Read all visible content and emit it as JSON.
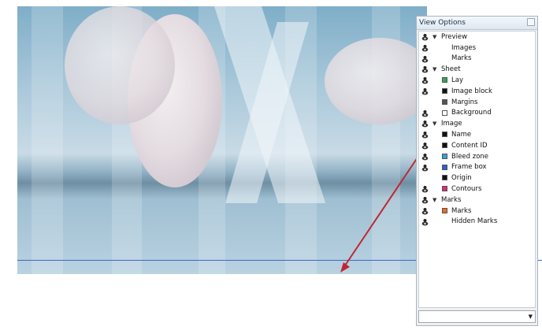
{
  "panel": {
    "title": "View Options",
    "tree": [
      {
        "label": "Preview",
        "group": true,
        "eye": true
      },
      {
        "label": "Images",
        "eye": true
      },
      {
        "label": "Marks",
        "eye": true
      },
      {
        "label": "Sheet",
        "group": true,
        "eye": true
      },
      {
        "label": "Lay",
        "eye": true,
        "swatch": "#2aa84a"
      },
      {
        "label": "Image block",
        "eye": true,
        "swatch": "#111111"
      },
      {
        "label": "Margins",
        "eye": false,
        "swatch": "#555555"
      },
      {
        "label": "Background",
        "eye": true,
        "swatch": "#ffffff"
      },
      {
        "label": "Image",
        "group": true,
        "eye": true
      },
      {
        "label": "Name",
        "eye": true,
        "swatch": "#111111"
      },
      {
        "label": "Content ID",
        "eye": true,
        "swatch": "#111111"
      },
      {
        "label": "Bleed zone",
        "eye": true,
        "swatch": "#33a0d8"
      },
      {
        "label": "Frame box",
        "eye": true,
        "swatch": "#2a5fd6"
      },
      {
        "label": "Origin",
        "eye": false,
        "swatch": "#111111"
      },
      {
        "label": "Contours",
        "eye": true,
        "swatch": "#e0277f"
      },
      {
        "label": "Marks",
        "group": true,
        "eye": true
      },
      {
        "label": "Marks",
        "eye": true,
        "swatch": "#ef6a1a"
      },
      {
        "label": "Hidden Marks",
        "eye": true
      }
    ],
    "dropdown_value": ""
  },
  "colors": {
    "guide_line": "#3f66c4",
    "arrow": "#c0272d"
  },
  "icons": {
    "visibility": "eye-icon",
    "expand": "triangle-down-icon",
    "close": "close-icon",
    "dropdown": "chevron-down-icon"
  }
}
